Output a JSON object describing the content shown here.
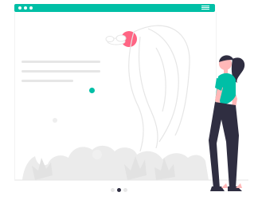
{
  "header": {
    "window_dots": 3,
    "menu_icon": "hamburger-icon"
  },
  "content": {
    "text_lines": 3,
    "list_dot_icon": "accent-dot-icon"
  },
  "carousel": {
    "dot_count": 3,
    "active_index": 1
  },
  "colors": {
    "accent": "#00bfa6",
    "sun": "#ff6584",
    "placeholder": "#e6e6e6",
    "dark": "#2f2e41",
    "skin": "#ffb8b8"
  }
}
